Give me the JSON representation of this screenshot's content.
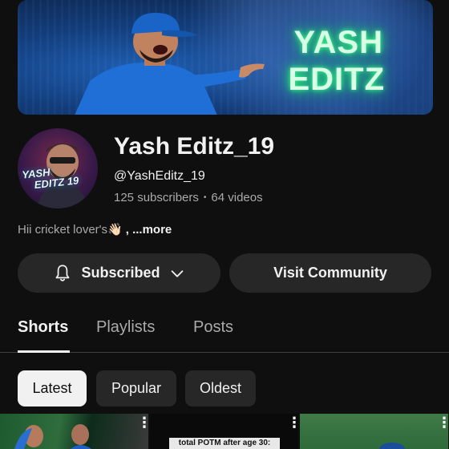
{
  "banner": {
    "title_line1": "YASH",
    "title_line2": "EDITZ"
  },
  "avatar": {
    "text_line1": "YASH",
    "text_line2": "EDITZ 19"
  },
  "channel": {
    "name": "Yash Editz_19",
    "handle": "@YashEditz_19",
    "subscribers": "125 subscribers",
    "separator": "•",
    "videos": "64 videos",
    "description": "Hii cricket lover's",
    "wave_emoji": "👋🏻",
    "more": ", ...more"
  },
  "actions": {
    "subscribed_label": "Subscribed",
    "community_label": "Visit Community"
  },
  "tabs": [
    {
      "label": "Shorts",
      "active": true
    },
    {
      "label": "Playlists",
      "active": false
    },
    {
      "label": "Posts",
      "active": false
    }
  ],
  "chips": [
    {
      "label": "Latest",
      "active": true
    },
    {
      "label": "Popular",
      "active": false
    },
    {
      "label": "Oldest",
      "active": false
    }
  ],
  "shorts": [
    {
      "caption": ""
    },
    {
      "caption": "total POTM after age 30:"
    },
    {
      "caption": ""
    }
  ],
  "colors": {
    "background": "#0f0f0f",
    "surface": "#272727",
    "text_primary": "#f1f1f1",
    "text_secondary": "#aaaaaa",
    "banner_glow": "#38ff8c"
  },
  "icons": {
    "bell": "bell-icon",
    "chevron": "chevron-down-icon",
    "menu": "more-vert-icon"
  }
}
